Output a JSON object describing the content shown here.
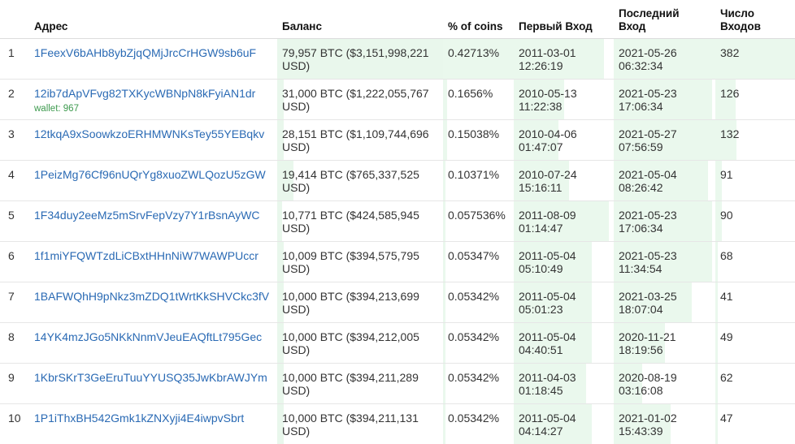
{
  "headers": {
    "num": "",
    "address": "Адрес",
    "balance": "Баланс",
    "percent": "% of coins",
    "first_in_1": "Первый Вход",
    "last_in_1": "Последний",
    "last_in_2": "Вход",
    "count_1": "Число",
    "count_2": "Входов"
  },
  "rows": [
    {
      "num": "1",
      "address": "1FeexV6bAHb8ybZjqQMjJrcCrHGW9sb6uF",
      "wallet": "",
      "balance_1": "79,957 BTC ($3,151,998,221",
      "balance_2": "USD)",
      "percent": "0.42713%",
      "first_date": "2011-03-01",
      "first_time": "12:26:19",
      "last_date": "2021-05-26",
      "last_time": "06:32:34",
      "count": "382",
      "bar_bal": 1.0,
      "bar_pct": 1.0,
      "bar_first": 0.9,
      "bar_last": 1.0,
      "bar_count": 1.0
    },
    {
      "num": "2",
      "address": "12ib7dApVFvg82TXKycWBNpN8kFyiAN1dr",
      "wallet": "wallet: 967",
      "balance_1": "31,000 BTC ($1,222,055,767",
      "balance_2": "USD)",
      "percent": "0.1656%",
      "first_date": "2010-05-13",
      "first_time": "11:22:38",
      "last_date": "2021-05-23",
      "last_time": "17:06:34",
      "count": "126",
      "bar_bal": 0.04,
      "bar_pct": 0.06,
      "bar_first": 0.5,
      "bar_last": 0.97,
      "bar_count": 0.25
    },
    {
      "num": "3",
      "address": "12tkqA9xSoowkzoERHMWNKsTey55YEBqkv",
      "wallet": "",
      "balance_1": "28,151 BTC ($1,109,744,696",
      "balance_2": "USD)",
      "percent": "0.15038%",
      "first_date": "2010-04-06",
      "first_time": "01:47:07",
      "last_date": "2021-05-27",
      "last_time": "07:56:59",
      "count": "132",
      "bar_bal": 0.04,
      "bar_pct": 0.06,
      "bar_first": 0.45,
      "bar_last": 1.0,
      "bar_count": 0.27
    },
    {
      "num": "4",
      "address": "1PeizMg76Cf96nUQrYg8xuoZWLQozU5zGW",
      "wallet": "",
      "balance_1": "19,414 BTC ($765,337,525",
      "balance_2": "USD)",
      "percent": "0.10371%",
      "first_date": "2010-07-24",
      "first_time": "15:16:11",
      "last_date": "2021-05-04",
      "last_time": "08:26:42",
      "count": "91",
      "bar_bal": 0.1,
      "bar_pct": 0.04,
      "bar_first": 0.55,
      "bar_last": 0.93,
      "bar_count": 0.08
    },
    {
      "num": "5",
      "address": "1F34duy2eeMz5mSrvFepVzy7Y1rBsnAyWC",
      "wallet": "",
      "balance_1": "10,771 BTC ($424,585,945",
      "balance_2": "USD)",
      "percent": "0.057536%",
      "first_date": "2011-08-09",
      "first_time": "01:14:47",
      "last_date": "2021-05-23",
      "last_time": "17:06:34",
      "count": "90",
      "bar_bal": 0.03,
      "bar_pct": 0.03,
      "bar_first": 0.95,
      "bar_last": 0.97,
      "bar_count": 0.08
    },
    {
      "num": "6",
      "address": "1f1miYFQWTzdLiCBxtHHnNiW7WAWPUccr",
      "wallet": "",
      "balance_1": "10,009 BTC ($394,575,795",
      "balance_2": "USD)",
      "percent": "0.05347%",
      "first_date": "2011-05-04",
      "first_time": "05:10:49",
      "last_date": "2021-05-23",
      "last_time": "11:34:54",
      "count": "68",
      "bar_bal": 0.04,
      "bar_pct": 0.03,
      "bar_first": 0.78,
      "bar_last": 0.97,
      "bar_count": 0.03
    },
    {
      "num": "7",
      "address": "1BAFWQhH9pNkz3mZDQ1tWrtKkSHVCkc3fV",
      "wallet": "",
      "balance_1": "10,000 BTC ($394,213,699",
      "balance_2": "USD)",
      "percent": "0.05342%",
      "first_date": "2011-05-04",
      "first_time": "05:01:23",
      "last_date": "2021-03-25",
      "last_time": "18:07:04",
      "count": "41",
      "bar_bal": 0.04,
      "bar_pct": 0.03,
      "bar_first": 0.78,
      "bar_last": 0.77,
      "bar_count": 0.03
    },
    {
      "num": "8",
      "address": "14YK4mzJGo5NKkNnmVJeuEAQftLt795Gec",
      "wallet": "",
      "balance_1": "10,000 BTC ($394,212,005",
      "balance_2": "USD)",
      "percent": "0.05342%",
      "first_date": "2011-05-04",
      "first_time": "04:40:51",
      "last_date": "2020-11-21",
      "last_time": "18:19:56",
      "count": "49",
      "bar_bal": 0.04,
      "bar_pct": 0.03,
      "bar_first": 0.78,
      "bar_last": 0.5,
      "bar_count": 0.03
    },
    {
      "num": "9",
      "address": "1KbrSKrT3GeEruTuuYYUSQ35JwKbrAWJYm",
      "wallet": "",
      "balance_1": "10,000 BTC ($394,211,289",
      "balance_2": "USD)",
      "percent": "0.05342%",
      "first_date": "2011-04-03",
      "first_time": "01:18:45",
      "last_date": "2020-08-19",
      "last_time": "03:16:08",
      "count": "62",
      "bar_bal": 0.04,
      "bar_pct": 0.03,
      "bar_first": 0.72,
      "bar_last": 0.28,
      "bar_count": 0.03
    },
    {
      "num": "10",
      "address": "1P1iThxBH542Gmk1kZNXyji4E4iwpvSbrt",
      "wallet": "",
      "balance_1": "10,000 BTC ($394,211,131",
      "balance_2": "USD)",
      "percent": "0.05342%",
      "first_date": "2011-05-04",
      "first_time": "04:14:27",
      "last_date": "2021-01-02",
      "last_time": "15:43:39",
      "count": "47",
      "bar_bal": 0.04,
      "bar_pct": 0.03,
      "bar_first": 0.78,
      "bar_last": 0.56,
      "bar_count": 0.03
    }
  ]
}
